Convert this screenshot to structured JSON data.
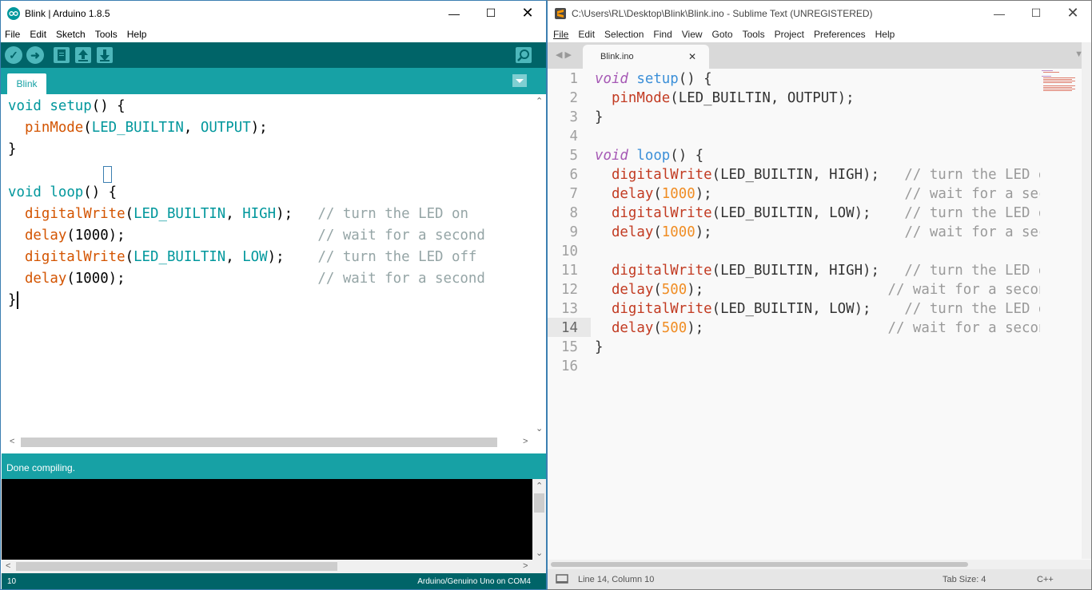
{
  "arduino": {
    "title": "Blink | Arduino 1.8.5",
    "menu": [
      "File",
      "Edit",
      "Sketch",
      "Tools",
      "Help"
    ],
    "tab": "Blink",
    "code": [
      [
        [
          "void",
          "kw"
        ],
        [
          " ",
          ""
        ],
        [
          "setup",
          "kw"
        ],
        [
          "() {",
          ""
        ]
      ],
      [
        [
          "  ",
          ""
        ],
        [
          "pinMode",
          "fn"
        ],
        [
          "(",
          ""
        ],
        [
          "LED_BUILTIN",
          "const"
        ],
        [
          ", ",
          ""
        ],
        [
          "OUTPUT",
          "const"
        ],
        [
          ");",
          ""
        ]
      ],
      [
        [
          "}",
          ""
        ]
      ],
      [
        [
          "",
          ""
        ]
      ],
      [
        [
          "void",
          "kw"
        ],
        [
          " ",
          ""
        ],
        [
          "loop",
          "kw"
        ],
        [
          "() {",
          ""
        ]
      ],
      [
        [
          "  ",
          ""
        ],
        [
          "digitalWrite",
          "fn"
        ],
        [
          "(",
          ""
        ],
        [
          "LED_BUILTIN",
          "const"
        ],
        [
          ", ",
          ""
        ],
        [
          "HIGH",
          "const"
        ],
        [
          ");   ",
          ""
        ],
        [
          "// turn the LED on",
          "cm"
        ]
      ],
      [
        [
          "  ",
          ""
        ],
        [
          "delay",
          "fn"
        ],
        [
          "(1000);                       ",
          ""
        ],
        [
          "// wait for a second",
          "cm"
        ]
      ],
      [
        [
          "  ",
          ""
        ],
        [
          "digitalWrite",
          "fn"
        ],
        [
          "(",
          ""
        ],
        [
          "LED_BUILTIN",
          "const"
        ],
        [
          ", ",
          ""
        ],
        [
          "LOW",
          "const"
        ],
        [
          ");    ",
          ""
        ],
        [
          "// turn the LED off",
          "cm"
        ]
      ],
      [
        [
          "  ",
          ""
        ],
        [
          "delay",
          "fn"
        ],
        [
          "(1000);                       ",
          ""
        ],
        [
          "// wait for a second",
          "cm"
        ]
      ],
      [
        [
          "}",
          ""
        ]
      ]
    ],
    "status": "Done compiling.",
    "footer_line": "10",
    "footer_board": "Arduino/Genuino Uno on COM4"
  },
  "sublime": {
    "title": "C:\\Users\\RL\\Desktop\\Blink\\Blink.ino - Sublime Text (UNREGISTERED)",
    "menu": [
      "File",
      "Edit",
      "Selection",
      "Find",
      "View",
      "Goto",
      "Tools",
      "Project",
      "Preferences",
      "Help"
    ],
    "tab": "Blink.ino",
    "line_numbers": [
      "1",
      "2",
      "3",
      "4",
      "5",
      "6",
      "7",
      "8",
      "9",
      "10",
      "11",
      "12",
      "13",
      "14",
      "15",
      "16"
    ],
    "code": [
      [
        [
          "void",
          "kw"
        ],
        [
          " ",
          ""
        ],
        [
          "setup",
          "fn"
        ],
        [
          "() {",
          ""
        ]
      ],
      [
        [
          "  ",
          ""
        ],
        [
          "pinMode",
          "bi"
        ],
        [
          "(LED_BUILTIN, OUTPUT);",
          ""
        ]
      ],
      [
        [
          "}",
          ""
        ]
      ],
      [
        [
          "",
          ""
        ]
      ],
      [
        [
          "void",
          "kw"
        ],
        [
          " ",
          ""
        ],
        [
          "loop",
          "fn"
        ],
        [
          "() {",
          ""
        ]
      ],
      [
        [
          "  ",
          ""
        ],
        [
          "digitalWrite",
          "bi"
        ],
        [
          "(LED_BUILTIN, HIGH);   ",
          ""
        ],
        [
          "// turn the LED on",
          "cm"
        ]
      ],
      [
        [
          "  ",
          ""
        ],
        [
          "delay",
          "bi"
        ],
        [
          "(",
          ""
        ],
        [
          "1000",
          "num"
        ],
        [
          ");                       ",
          ""
        ],
        [
          "// wait for a second",
          "cm"
        ]
      ],
      [
        [
          "  ",
          ""
        ],
        [
          "digitalWrite",
          "bi"
        ],
        [
          "(LED_BUILTIN, LOW);    ",
          ""
        ],
        [
          "// turn the LED off",
          "cm"
        ]
      ],
      [
        [
          "  ",
          ""
        ],
        [
          "delay",
          "bi"
        ],
        [
          "(",
          ""
        ],
        [
          "1000",
          "num"
        ],
        [
          ");                       ",
          ""
        ],
        [
          "// wait for a second",
          "cm"
        ]
      ],
      [
        [
          "",
          ""
        ]
      ],
      [
        [
          "  ",
          ""
        ],
        [
          "digitalWrite",
          "bi"
        ],
        [
          "(LED_BUILTIN, HIGH);   ",
          ""
        ],
        [
          "// turn the LED on",
          "cm"
        ]
      ],
      [
        [
          "  ",
          ""
        ],
        [
          "delay",
          "bi"
        ],
        [
          "(",
          ""
        ],
        [
          "500",
          "num"
        ],
        [
          ");                      ",
          ""
        ],
        [
          "// wait for a second",
          "cm"
        ]
      ],
      [
        [
          "  ",
          ""
        ],
        [
          "digitalWrite",
          "bi"
        ],
        [
          "(LED_BUILTIN, LOW);    ",
          ""
        ],
        [
          "// turn the LED off",
          "cm"
        ]
      ],
      [
        [
          "  ",
          ""
        ],
        [
          "delay",
          "bi"
        ],
        [
          "(",
          ""
        ],
        [
          "500",
          "num"
        ],
        [
          ");                      ",
          ""
        ],
        [
          "// wait for a second",
          "cm"
        ]
      ],
      [
        [
          "}",
          ""
        ]
      ],
      [
        [
          "",
          ""
        ]
      ]
    ],
    "status_position": "Line 14, Column 10",
    "status_tabsize": "Tab Size: 4",
    "status_syntax": "C++"
  },
  "icons": [
    "arduino-logo-icon",
    "sublime-logo-icon",
    "verify-icon",
    "upload-icon",
    "new-icon",
    "open-icon",
    "save-icon",
    "serial-monitor-icon"
  ]
}
